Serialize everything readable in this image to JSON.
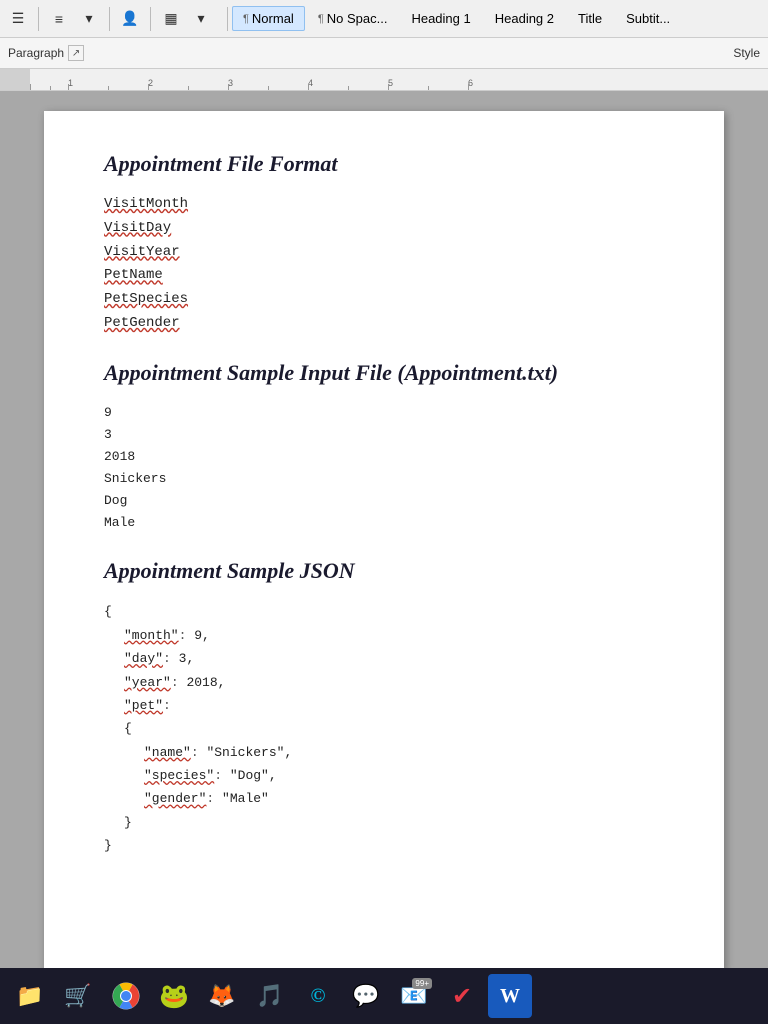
{
  "ribbon": {
    "styles": [
      {
        "id": "normal",
        "label": "Normal",
        "prefix": "¶",
        "active": true
      },
      {
        "id": "no-spacing",
        "label": "No Spac...",
        "prefix": "¶"
      },
      {
        "id": "heading1",
        "label": "Heading 1",
        "prefix": ""
      },
      {
        "id": "heading2",
        "label": "Heading 2",
        "prefix": ""
      },
      {
        "id": "title",
        "label": "Title",
        "prefix": ""
      },
      {
        "id": "subtitle",
        "label": "Subtit...",
        "prefix": ""
      }
    ],
    "paragraph_label": "Paragraph",
    "styles_label": "Style"
  },
  "ruler": {
    "marks": [
      "1",
      "2",
      "3",
      "4",
      "5",
      "6"
    ]
  },
  "document": {
    "sections": [
      {
        "id": "section1",
        "heading": "Appointment File Format",
        "fields": [
          "VisitMonth",
          "VisitDay",
          "VisitYear",
          "PetName",
          "PetSpecies",
          "PetGender"
        ]
      },
      {
        "id": "section2",
        "heading": "Appointment Sample Input File (Appointment.txt)",
        "values": [
          "9",
          "3",
          "2018",
          "Snickers",
          "Dog",
          "Male"
        ]
      },
      {
        "id": "section3",
        "heading": "Appointment Sample JSON",
        "json": {
          "month": 9,
          "day": 3,
          "year": 2018,
          "pet": {
            "name": "Snickers",
            "species": "Dog",
            "gender": "Male"
          }
        }
      }
    ]
  },
  "taskbar": {
    "icons": [
      {
        "id": "folder",
        "symbol": "📁",
        "label": "File Explorer"
      },
      {
        "id": "store",
        "symbol": "🏪",
        "label": "Microsoft Store"
      },
      {
        "id": "chrome",
        "symbol": "🌐",
        "label": "Google Chrome"
      },
      {
        "id": "frog",
        "symbol": "🐸",
        "label": "Frog App"
      },
      {
        "id": "firefox",
        "symbol": "🦊",
        "label": "Firefox"
      },
      {
        "id": "music",
        "symbol": "🎵",
        "label": "Music"
      },
      {
        "id": "net",
        "symbol": "©",
        "label": "Net App"
      },
      {
        "id": "whatsapp",
        "symbol": "💬",
        "label": "WhatsApp"
      },
      {
        "id": "email",
        "symbol": "📧",
        "label": "Email",
        "badge": "99+"
      },
      {
        "id": "check",
        "symbol": "✔",
        "label": "Check App"
      },
      {
        "id": "word",
        "symbol": "W",
        "label": "Microsoft Word"
      }
    ]
  }
}
